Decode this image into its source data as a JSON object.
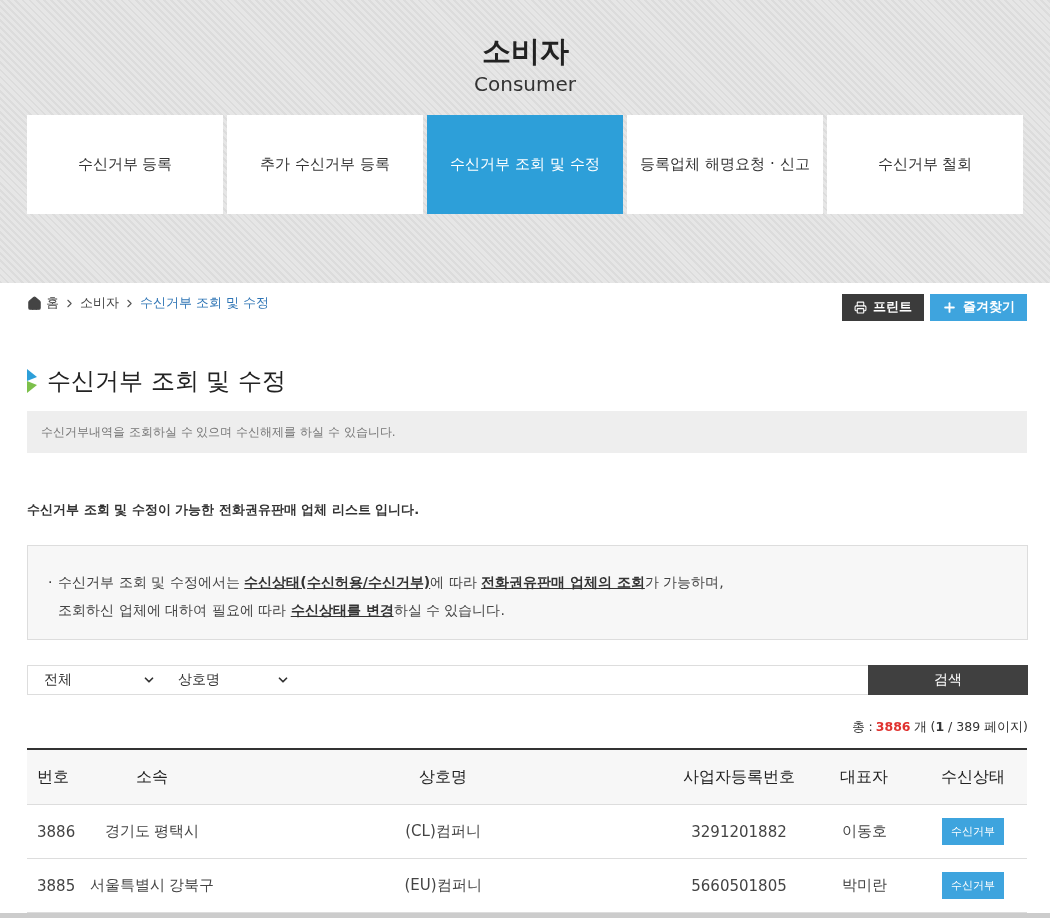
{
  "header": {
    "title": "소비자",
    "subtitle": "Consumer"
  },
  "tabs": [
    {
      "label": "수신거부 등록",
      "selected": false
    },
    {
      "label": "추가 수신거부 등록",
      "selected": false
    },
    {
      "label": "수신거부 조회 및 수정",
      "selected": true
    },
    {
      "label": "등록업체 해명요청 · 신고",
      "selected": false
    },
    {
      "label": "수신거부 철회",
      "selected": false
    }
  ],
  "breadcrumb": [
    {
      "label": "홈",
      "current": false
    },
    {
      "label": "소비자",
      "current": false
    },
    {
      "label": "수신거부 조회 및 수정",
      "current": true
    }
  ],
  "actions": [
    {
      "kind": "print",
      "label": "프린트"
    },
    {
      "kind": "bookmark",
      "label": "즐겨찾기"
    }
  ],
  "page_title": "수신거부 조회 및 수정",
  "description": "수신거부내역을 조회하실 수 있으며 수신해제를 하실 수 있습니다.",
  "list_intro": "수신거부 조회 및 수정이 가능한 전화권유판매 업체 리스트 입니다.",
  "notice": {
    "bullet": "·",
    "lines": [
      "수신거부 조회 및 수정에서는 **수신상태(수신허용/수신거부)**에 따라 **전화권유판매 업체의 조회**가 가능하며,",
      "조회하신 업체에 대하여 필요에 따라 **수신상태를 변경**하실 수 있습니다."
    ]
  },
  "search": {
    "selects": [
      "전체",
      "상호명"
    ],
    "button": "검색"
  },
  "count": {
    "label": "총 :",
    "total": "3886",
    "suffix": "개 (**1** / 389 페이지)"
  },
  "table": {
    "columns": [
      "번호",
      "소속",
      "상호명",
      "사업자등록번호",
      "대표자",
      "수신상태"
    ],
    "rows": [
      {
        "no": "3886",
        "region": "경기도 평택시",
        "company": "(CL)컴퍼니",
        "reg_no": "3291201882",
        "ceo": "이동호",
        "status": "수신거부"
      },
      {
        "no": "3885",
        "region": "서울특별시 강북구",
        "company": "(EU)컴퍼니",
        "reg_no": "5660501805",
        "ceo": "박미란",
        "status": "수신거부"
      }
    ]
  }
}
